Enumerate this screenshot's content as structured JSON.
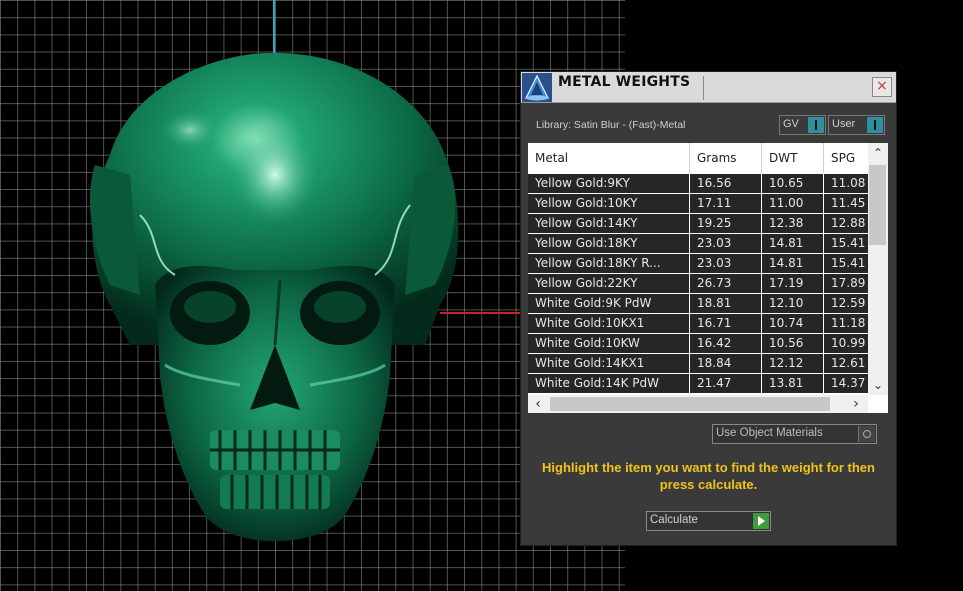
{
  "panel": {
    "title": "METAL WEIGHTS",
    "close_label": "×",
    "library_label": "Library: Satin Blur - (Fast)-Metal",
    "gv_label": "GV",
    "user_label": "User",
    "table": {
      "columns": [
        "Metal",
        "Grams",
        "DWT",
        "SPG"
      ],
      "rows": [
        [
          "Yellow Gold:9KY",
          "16.56",
          "10.65",
          "11.08"
        ],
        [
          "Yellow Gold:10KY",
          "17.11",
          "11.00",
          "11.45"
        ],
        [
          "Yellow Gold:14KY",
          "19.25",
          "12.38",
          "12.88"
        ],
        [
          "Yellow Gold:18KY",
          "23.03",
          "14.81",
          "15.41"
        ],
        [
          "Yellow Gold:18KY R...",
          "23.03",
          "14.81",
          "15.41"
        ],
        [
          "Yellow Gold:22KY",
          "26.73",
          "17.19",
          "17.89"
        ],
        [
          "White Gold:9K PdW",
          "18.81",
          "12.10",
          "12.59"
        ],
        [
          "White Gold:10KX1",
          "16.71",
          "10.74",
          "11.18"
        ],
        [
          "White Gold:10KW",
          "16.42",
          "10.56",
          "10.99"
        ],
        [
          "White Gold:14KX1",
          "18.84",
          "12.12",
          "12.61"
        ],
        [
          "White Gold:14K PdW",
          "21.47",
          "13.81",
          "14.37"
        ]
      ]
    },
    "use_object_materials_label": "Use Object Materials",
    "instructions": "Highlight the item you want to find the weight for then press calculate.",
    "calculate_label": "Calculate"
  },
  "scroll": {
    "up": "⌃",
    "down": "⌄",
    "left": "‹",
    "right": "›"
  },
  "colors": {
    "skull": "#0f7a52",
    "accent_teal": "#2f8f9d",
    "instruction_text": "#f0c31c",
    "row_bg": "#262626"
  }
}
